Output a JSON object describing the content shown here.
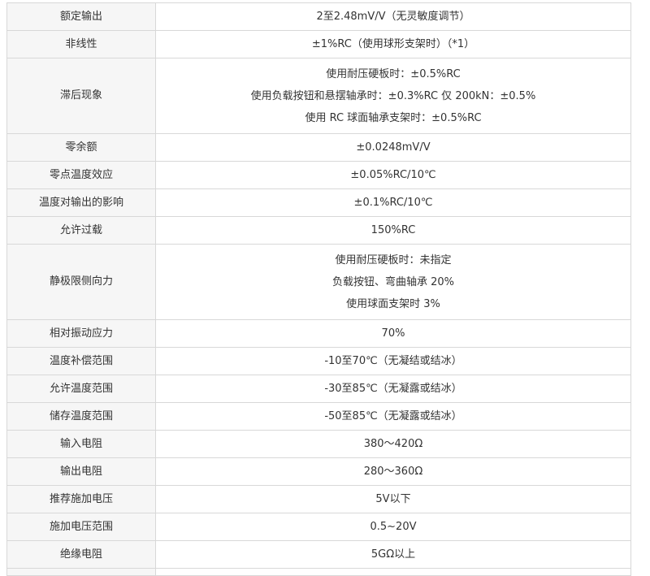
{
  "spec_table": {
    "rows": [
      {
        "label": "额定输出",
        "values": [
          "2至2.48mV/V（无灵敏度调节）"
        ]
      },
      {
        "label": "非线性",
        "values": [
          "±1%RC（使用球形支架时）（*1）"
        ]
      },
      {
        "label": "滞后现象",
        "values": [
          "使用耐压硬板时：±0.5%RC",
          "使用负载按钮和悬摆轴承时：±0.3%RC 仅 200kN：±0.5%",
          "使用 RC 球面轴承支架时：±0.5%RC"
        ]
      },
      {
        "label": "零余额",
        "values": [
          "±0.0248mV/V"
        ]
      },
      {
        "label": "零点温度效应",
        "values": [
          "±0.05%RC/10℃"
        ]
      },
      {
        "label": "温度对输出的影响",
        "values": [
          "±0.1%RC/10℃"
        ]
      },
      {
        "label": "允许过载",
        "values": [
          "150%RC"
        ]
      },
      {
        "label": "静极限侧向力",
        "values": [
          "使用耐压硬板时：未指定",
          "负载按钮、弯曲轴承 20%",
          "使用球面支架时 3%"
        ]
      },
      {
        "label": "相对振动应力",
        "values": [
          "70%"
        ]
      },
      {
        "label": "温度补偿范围",
        "values": [
          "-10至70℃（无凝结或结冰）"
        ]
      },
      {
        "label": "允许温度范围",
        "values": [
          "-30至85℃（无凝露或结冰）"
        ]
      },
      {
        "label": "储存温度范围",
        "values": [
          "-50至85℃（无凝露或结冰）"
        ]
      },
      {
        "label": "输入电阻",
        "values": [
          "380～420Ω"
        ]
      },
      {
        "label": "输出电阻",
        "values": [
          "280～360Ω"
        ]
      },
      {
        "label": "推荐施加电压",
        "values": [
          "5V以下"
        ]
      },
      {
        "label": "施加电压范围",
        "values": [
          "0.5~20V"
        ]
      },
      {
        "label": "绝缘电阻",
        "values": [
          "5GΩ以上"
        ]
      }
    ]
  }
}
